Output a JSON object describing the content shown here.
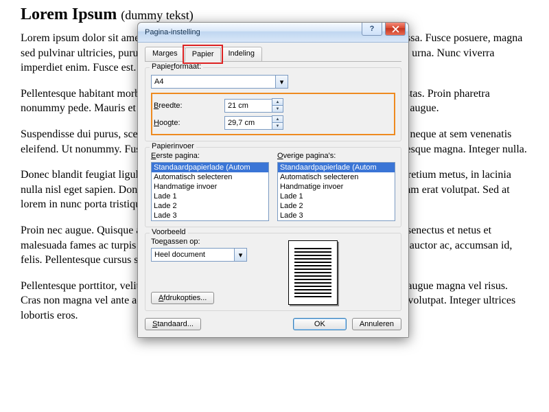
{
  "doc": {
    "title_main": "Lorem Ipsum",
    "title_sub": "(dummy tekst)",
    "p1": "Lorem ipsum dolor sit amet, consectetuer adipiscing elit. Maecenas porttitor congue massa. Fusce posuere, magna sed pulvinar ultricies, purus lectus malesuada libero, sit amet commodo magna eros quis urna. Nunc viverra imperdiet enim. Fusce est. Vivamus a tellus.",
    "p2": "Pellentesque habitant morbi tristique senectus et netus et malesuada fames ac turpis egestas. Proin pharetra nonummy pede. Mauris et orci. Aenean nec lorem. In porttitor. Donec laoreet nonummy augue.",
    "p3": "Suspendisse dui purus, scelerisque at, vulputate vitae, pretium mattis, nunc. Mauris eget neque at sem venenatis eleifend. Ut nonummy. Fusce aliquet pede non pede. Suspendisse dapibus lorem pellentesque magna. Integer nulla.",
    "p4": "Donec blandit feugiat ligula. Donec hendrerit, felis et imperdiet euismod, purus ipsum pretium metus, in lacinia nulla nisl eget sapien. Donec ut est in lectus consequat consequat. Etiam eget dui. Aliquam erat volutpat. Sed at lorem in nunc porta tristique.",
    "p5": "Proin nec augue. Quisque aliquam tempor magna. Pellentesque habitant morbi tristique senectus et netus et malesuada fames ac turpis egestas. Nunc ac magna. Maecenas odio dolor, vulputate vel, auctor ac, accumsan id, felis. Pellentesque cursus sagittis felis.",
    "p6": "Pellentesque porttitor, velit lacinia egestas auctor, diam eros tempus arcu, nec vulputate augue magna vel risus. Cras non magna vel ante adipiscing rhoncus. Vivamus a mi. Morbi neque. Aliquam erat volutpat. Integer ultrices lobortis eros."
  },
  "dialog": {
    "title": "Pagina-instelling",
    "tabs": {
      "margins": "Marges",
      "paper": "Papier",
      "layout": "Indeling"
    },
    "paper_format_label": "Papierformaat:",
    "format_value": "A4",
    "width_label": "Breedte:",
    "width_value": "21 cm",
    "height_label": "Hoogte:",
    "height_value": "29,7 cm",
    "feed_label": "Papierinvoer",
    "first_page_label": "Eerste pagina:",
    "other_pages_label": "Overige pagina's:",
    "tray_items": [
      "Standaardpapierlade (Autom",
      "Automatisch selecteren",
      "Handmatige invoer",
      "Lade 1",
      "Lade 2",
      "Lade 3"
    ],
    "preview_label": "Voorbeeld",
    "apply_to_label": "Toepassen op:",
    "apply_to_value": "Heel document",
    "print_options": "Afdrukopties...",
    "default_btn": "Standaard...",
    "ok": "OK",
    "cancel": "Annuleren"
  }
}
